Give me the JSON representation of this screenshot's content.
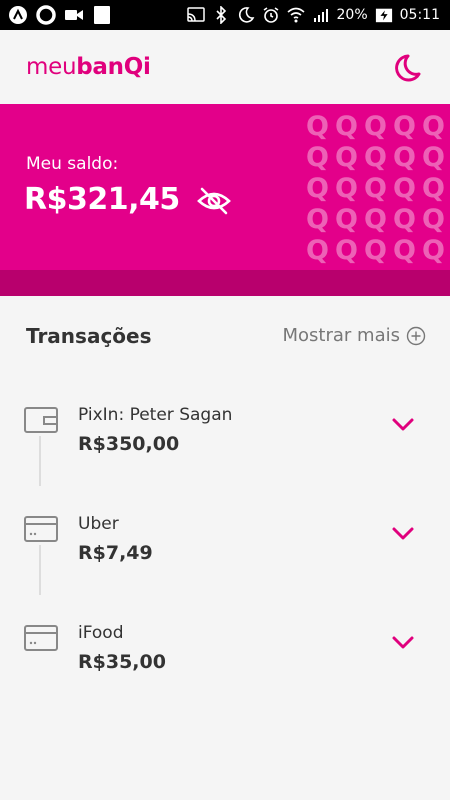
{
  "status_bar": {
    "battery": "20%",
    "time": "05:11"
  },
  "app": {
    "logo_light": "meu",
    "logo_bold": "banQi"
  },
  "balance": {
    "label": "Meu saldo:",
    "value": "R$321,45",
    "pattern_letter": "Q"
  },
  "transactions": {
    "title": "Transações",
    "more_label": "Mostrar mais",
    "items": [
      {
        "name": "PixIn: Peter Sagan",
        "amount": "R$350,00",
        "icon": "wallet-icon"
      },
      {
        "name": "Uber",
        "amount": "R$7,49",
        "icon": "card-icon"
      },
      {
        "name": "iFood",
        "amount": "R$35,00",
        "icon": "card-icon"
      }
    ]
  },
  "colors": {
    "brand": "#e0007d",
    "card": "#e3008a",
    "card_strip": "#b8006d"
  }
}
